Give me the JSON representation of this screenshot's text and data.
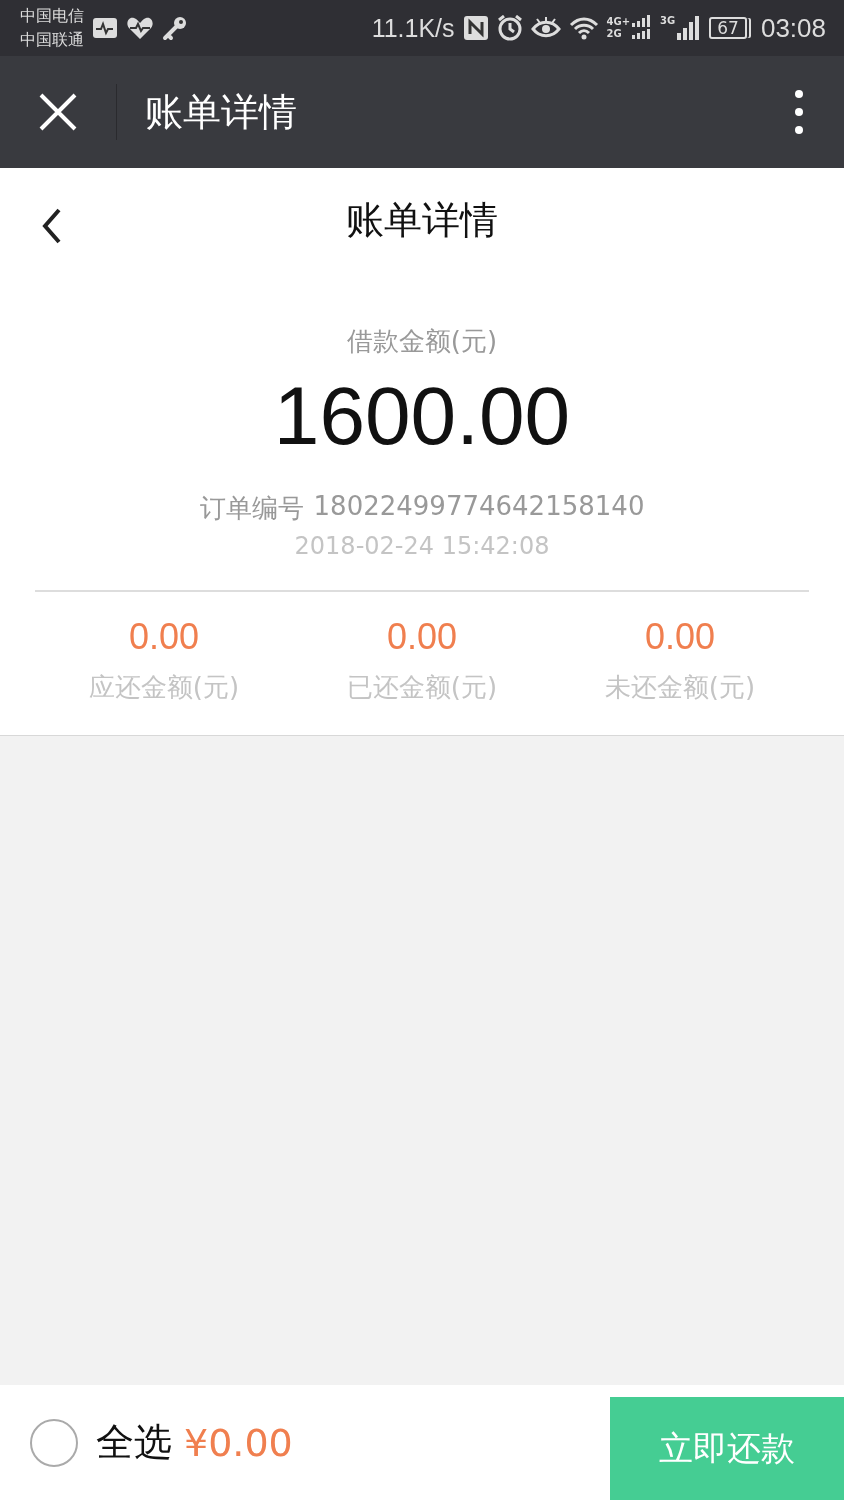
{
  "status_bar": {
    "carriers": [
      "中国电信",
      "中国联通"
    ],
    "speed": "11.1K/s",
    "network_labels": [
      "4G+",
      "2G",
      "3G"
    ],
    "battery": "67",
    "time": "03:08"
  },
  "nav_bar": {
    "title": "账单详情"
  },
  "header": {
    "title": "账单详情"
  },
  "loan": {
    "label": "借款金额(元)",
    "amount": "1600.00",
    "order_label": "订单编号",
    "order_number": "18022499774642158140",
    "datetime": "2018-02-24 15:42:08"
  },
  "summary": [
    {
      "value": "0.00",
      "label": "应还金额(元)"
    },
    {
      "value": "0.00",
      "label": "已还金额(元)"
    },
    {
      "value": "0.00",
      "label": "未还金额(元)"
    }
  ],
  "footer": {
    "select_all": {
      "label": "全选",
      "checked": false
    },
    "total": "¥0.00",
    "pay_button": "立即还款"
  }
}
